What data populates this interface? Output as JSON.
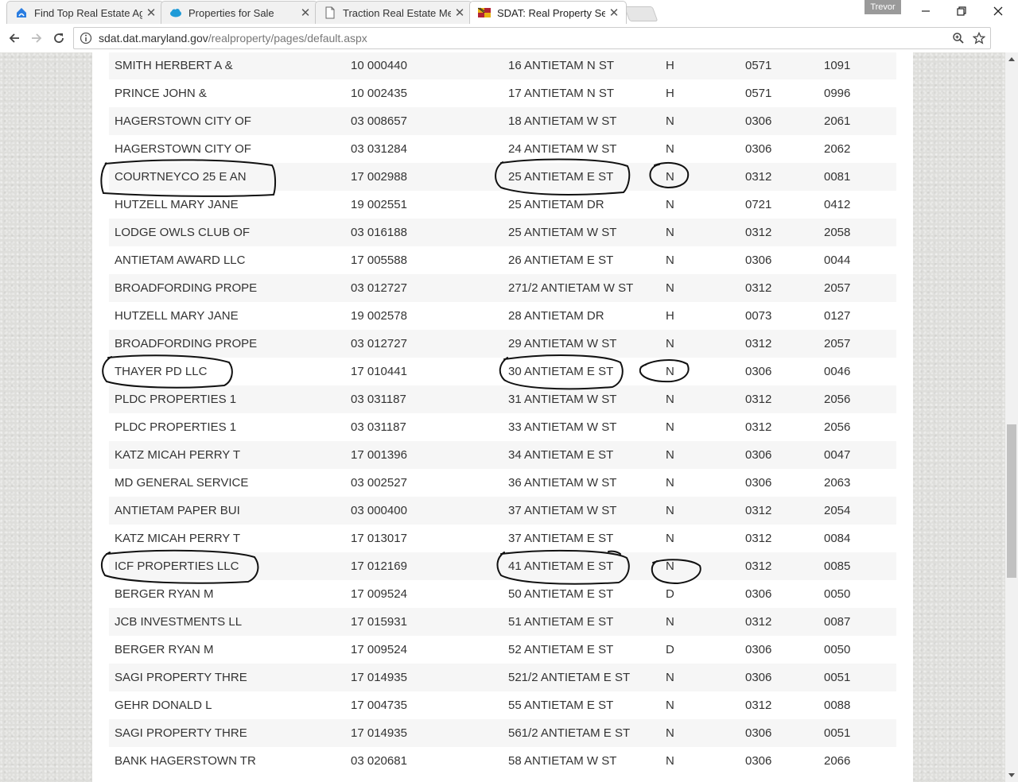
{
  "browser": {
    "tabs": [
      {
        "title": "Find Top Real Estate Age",
        "icon": "zillow-house-icon"
      },
      {
        "title": "Properties for Sale",
        "icon": "salesforce-cloud-icon"
      },
      {
        "title": "Traction Real Estate Men",
        "icon": "document-icon"
      },
      {
        "title": "SDAT: Real Property Sear",
        "icon": "maryland-flag-icon",
        "active": true
      }
    ],
    "profile_name": "Trevor",
    "address_bar": {
      "host": "sdat.dat.maryland.gov",
      "path": "/realproperty/pages/default.aspx"
    }
  },
  "results": {
    "rows": [
      {
        "owner": "SMITH HERBERT A &",
        "account": "10 000440",
        "address": "16 ANTIETAM N ST",
        "type": "H",
        "map": "0571",
        "parcel": "1091"
      },
      {
        "owner": "PRINCE JOHN &",
        "account": "10 002435",
        "address": "17 ANTIETAM N ST",
        "type": "H",
        "map": "0571",
        "parcel": "0996"
      },
      {
        "owner": "HAGERSTOWN CITY OF",
        "account": "03 008657",
        "address": "18 ANTIETAM W ST",
        "type": "N",
        "map": "0306",
        "parcel": "2061"
      },
      {
        "owner": "HAGERSTOWN CITY OF",
        "account": "03 031284",
        "address": "24 ANTIETAM W ST",
        "type": "N",
        "map": "0306",
        "parcel": "2062"
      },
      {
        "owner": "COURTNEYCO 25 E AN",
        "account": "17 002988",
        "address": "25 ANTIETAM E ST",
        "type": "N",
        "map": "0312",
        "parcel": "0081"
      },
      {
        "owner": "HUTZELL MARY JANE",
        "account": "19 002551",
        "address": "25 ANTIETAM DR",
        "type": "N",
        "map": "0721",
        "parcel": "0412"
      },
      {
        "owner": "LODGE OWLS CLUB OF",
        "account": "03 016188",
        "address": "25 ANTIETAM W ST",
        "type": "N",
        "map": "0312",
        "parcel": "2058"
      },
      {
        "owner": "ANTIETAM AWARD LLC",
        "account": "17 005588",
        "address": "26 ANTIETAM E ST",
        "type": "N",
        "map": "0306",
        "parcel": "0044"
      },
      {
        "owner": "BROADFORDING PROPE",
        "account": "03 012727",
        "address": "271/2 ANTIETAM W ST",
        "type": "N",
        "map": "0312",
        "parcel": "2057"
      },
      {
        "owner": "HUTZELL MARY JANE",
        "account": "19 002578",
        "address": "28 ANTIETAM DR",
        "type": "H",
        "map": "0073",
        "parcel": "0127"
      },
      {
        "owner": "BROADFORDING PROPE",
        "account": "03 012727",
        "address": "29 ANTIETAM W ST",
        "type": "N",
        "map": "0312",
        "parcel": "2057"
      },
      {
        "owner": "THAYER PD LLC",
        "account": "17 010441",
        "address": "30 ANTIETAM E ST",
        "type": "N",
        "map": "0306",
        "parcel": "0046"
      },
      {
        "owner": "PLDC PROPERTIES 1",
        "account": "03 031187",
        "address": "31 ANTIETAM W ST",
        "type": "N",
        "map": "0312",
        "parcel": "2056"
      },
      {
        "owner": "PLDC PROPERTIES 1",
        "account": "03 031187",
        "address": "33 ANTIETAM W ST",
        "type": "N",
        "map": "0312",
        "parcel": "2056"
      },
      {
        "owner": "KATZ MICAH PERRY T",
        "account": "17 001396",
        "address": "34 ANTIETAM E ST",
        "type": "N",
        "map": "0306",
        "parcel": "0047"
      },
      {
        "owner": "MD GENERAL SERVICE",
        "account": "03 002527",
        "address": "36 ANTIETAM W ST",
        "type": "N",
        "map": "0306",
        "parcel": "2063"
      },
      {
        "owner": "ANTIETAM PAPER BUI",
        "account": "03 000400",
        "address": "37 ANTIETAM W ST",
        "type": "N",
        "map": "0312",
        "parcel": "2054"
      },
      {
        "owner": "KATZ MICAH PERRY T",
        "account": "17 013017",
        "address": "37 ANTIETAM E ST",
        "type": "N",
        "map": "0312",
        "parcel": "0084"
      },
      {
        "owner": "ICF PROPERTIES LLC",
        "account": "17 012169",
        "address": "41 ANTIETAM E ST",
        "type": "N",
        "map": "0312",
        "parcel": "0085"
      },
      {
        "owner": "BERGER RYAN M",
        "account": "17 009524",
        "address": "50 ANTIETAM E ST",
        "type": "D",
        "map": "0306",
        "parcel": "0050"
      },
      {
        "owner": "JCB INVESTMENTS LL",
        "account": "17 015931",
        "address": "51 ANTIETAM E ST",
        "type": "N",
        "map": "0312",
        "parcel": "0087"
      },
      {
        "owner": "BERGER RYAN M",
        "account": "17 009524",
        "address": "52 ANTIETAM E ST",
        "type": "D",
        "map": "0306",
        "parcel": "0050"
      },
      {
        "owner": "SAGI PROPERTY THRE",
        "account": "17 014935",
        "address": "521/2 ANTIETAM E ST",
        "type": "N",
        "map": "0306",
        "parcel": "0051"
      },
      {
        "owner": "GEHR DONALD L",
        "account": "17 004735",
        "address": "55 ANTIETAM E ST",
        "type": "N",
        "map": "0312",
        "parcel": "0088"
      },
      {
        "owner": "SAGI PROPERTY THRE",
        "account": "17 014935",
        "address": "561/2 ANTIETAM E ST",
        "type": "N",
        "map": "0306",
        "parcel": "0051"
      },
      {
        "owner": "BANK HAGERSTOWN TR",
        "account": "03 020681",
        "address": "58 ANTIETAM W ST",
        "type": "N",
        "map": "0306",
        "parcel": "2066"
      }
    ]
  },
  "colors": {
    "owner_link": "#9c7524",
    "annotation_ink": "#111111"
  }
}
